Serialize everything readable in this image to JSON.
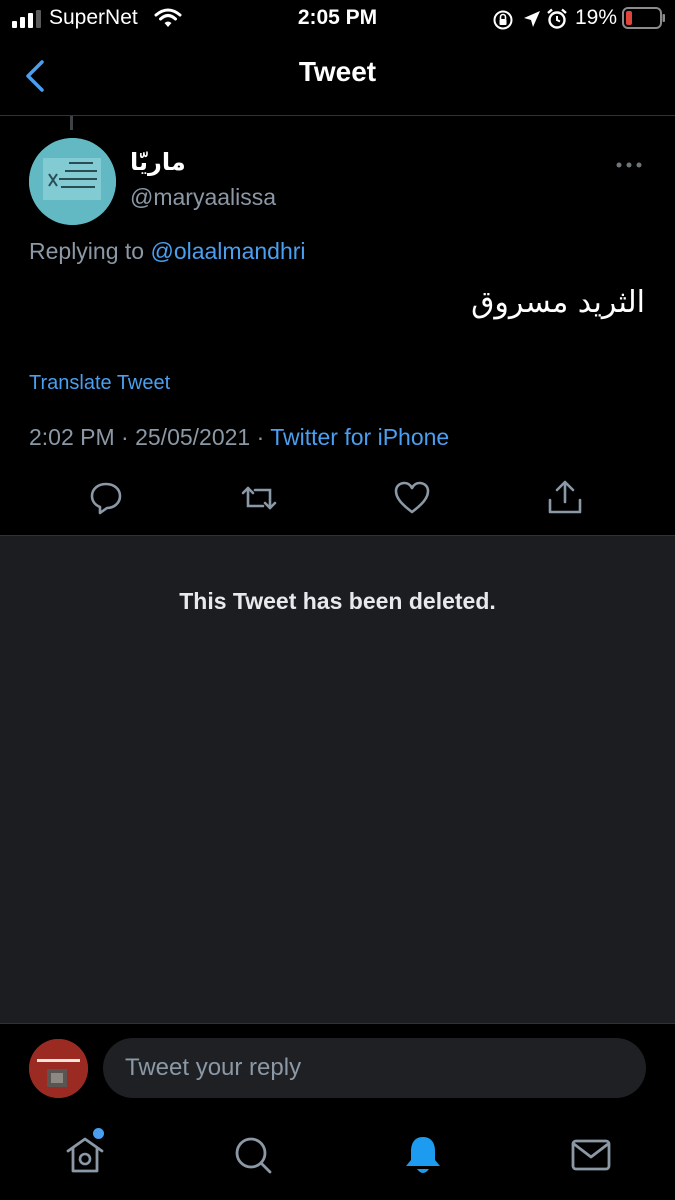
{
  "status_bar": {
    "carrier": "SuperNet",
    "time": "2:05 PM",
    "battery_percent": "19%",
    "battery_level": 0.19,
    "icons": [
      "signal-icon",
      "wifi-icon",
      "orientation-lock-icon",
      "location-icon",
      "alarm-icon",
      "battery-icon"
    ]
  },
  "nav": {
    "title": "Tweet",
    "back_icon": "chevron-left-icon"
  },
  "tweet": {
    "display_name": "ماريّا",
    "handle": "@maryaalissa",
    "replying_prefix": "Replying to",
    "replying_to": "@olaalmandhri",
    "text": "الثريد مسروق",
    "translate_label": "Translate Tweet",
    "timestamp": "2:02 PM · 25/05/2021 · ",
    "source": "Twitter for iPhone",
    "actions": [
      "reply-icon",
      "retweet-icon",
      "like-icon",
      "share-icon"
    ]
  },
  "deleted": {
    "message": "This Tweet has been deleted."
  },
  "reply_bar": {
    "placeholder": "Tweet your reply"
  },
  "tab_bar": {
    "items": [
      "home-icon",
      "search-icon",
      "notifications-icon",
      "messages-icon"
    ],
    "active": "notifications-icon",
    "home_badge": true
  },
  "colors": {
    "background": "#000000",
    "accent": "#4a9ff0",
    "secondary_text": "#8b98a5",
    "deleted_panel": "#1c1d21",
    "battery_low": "#e0443b"
  }
}
